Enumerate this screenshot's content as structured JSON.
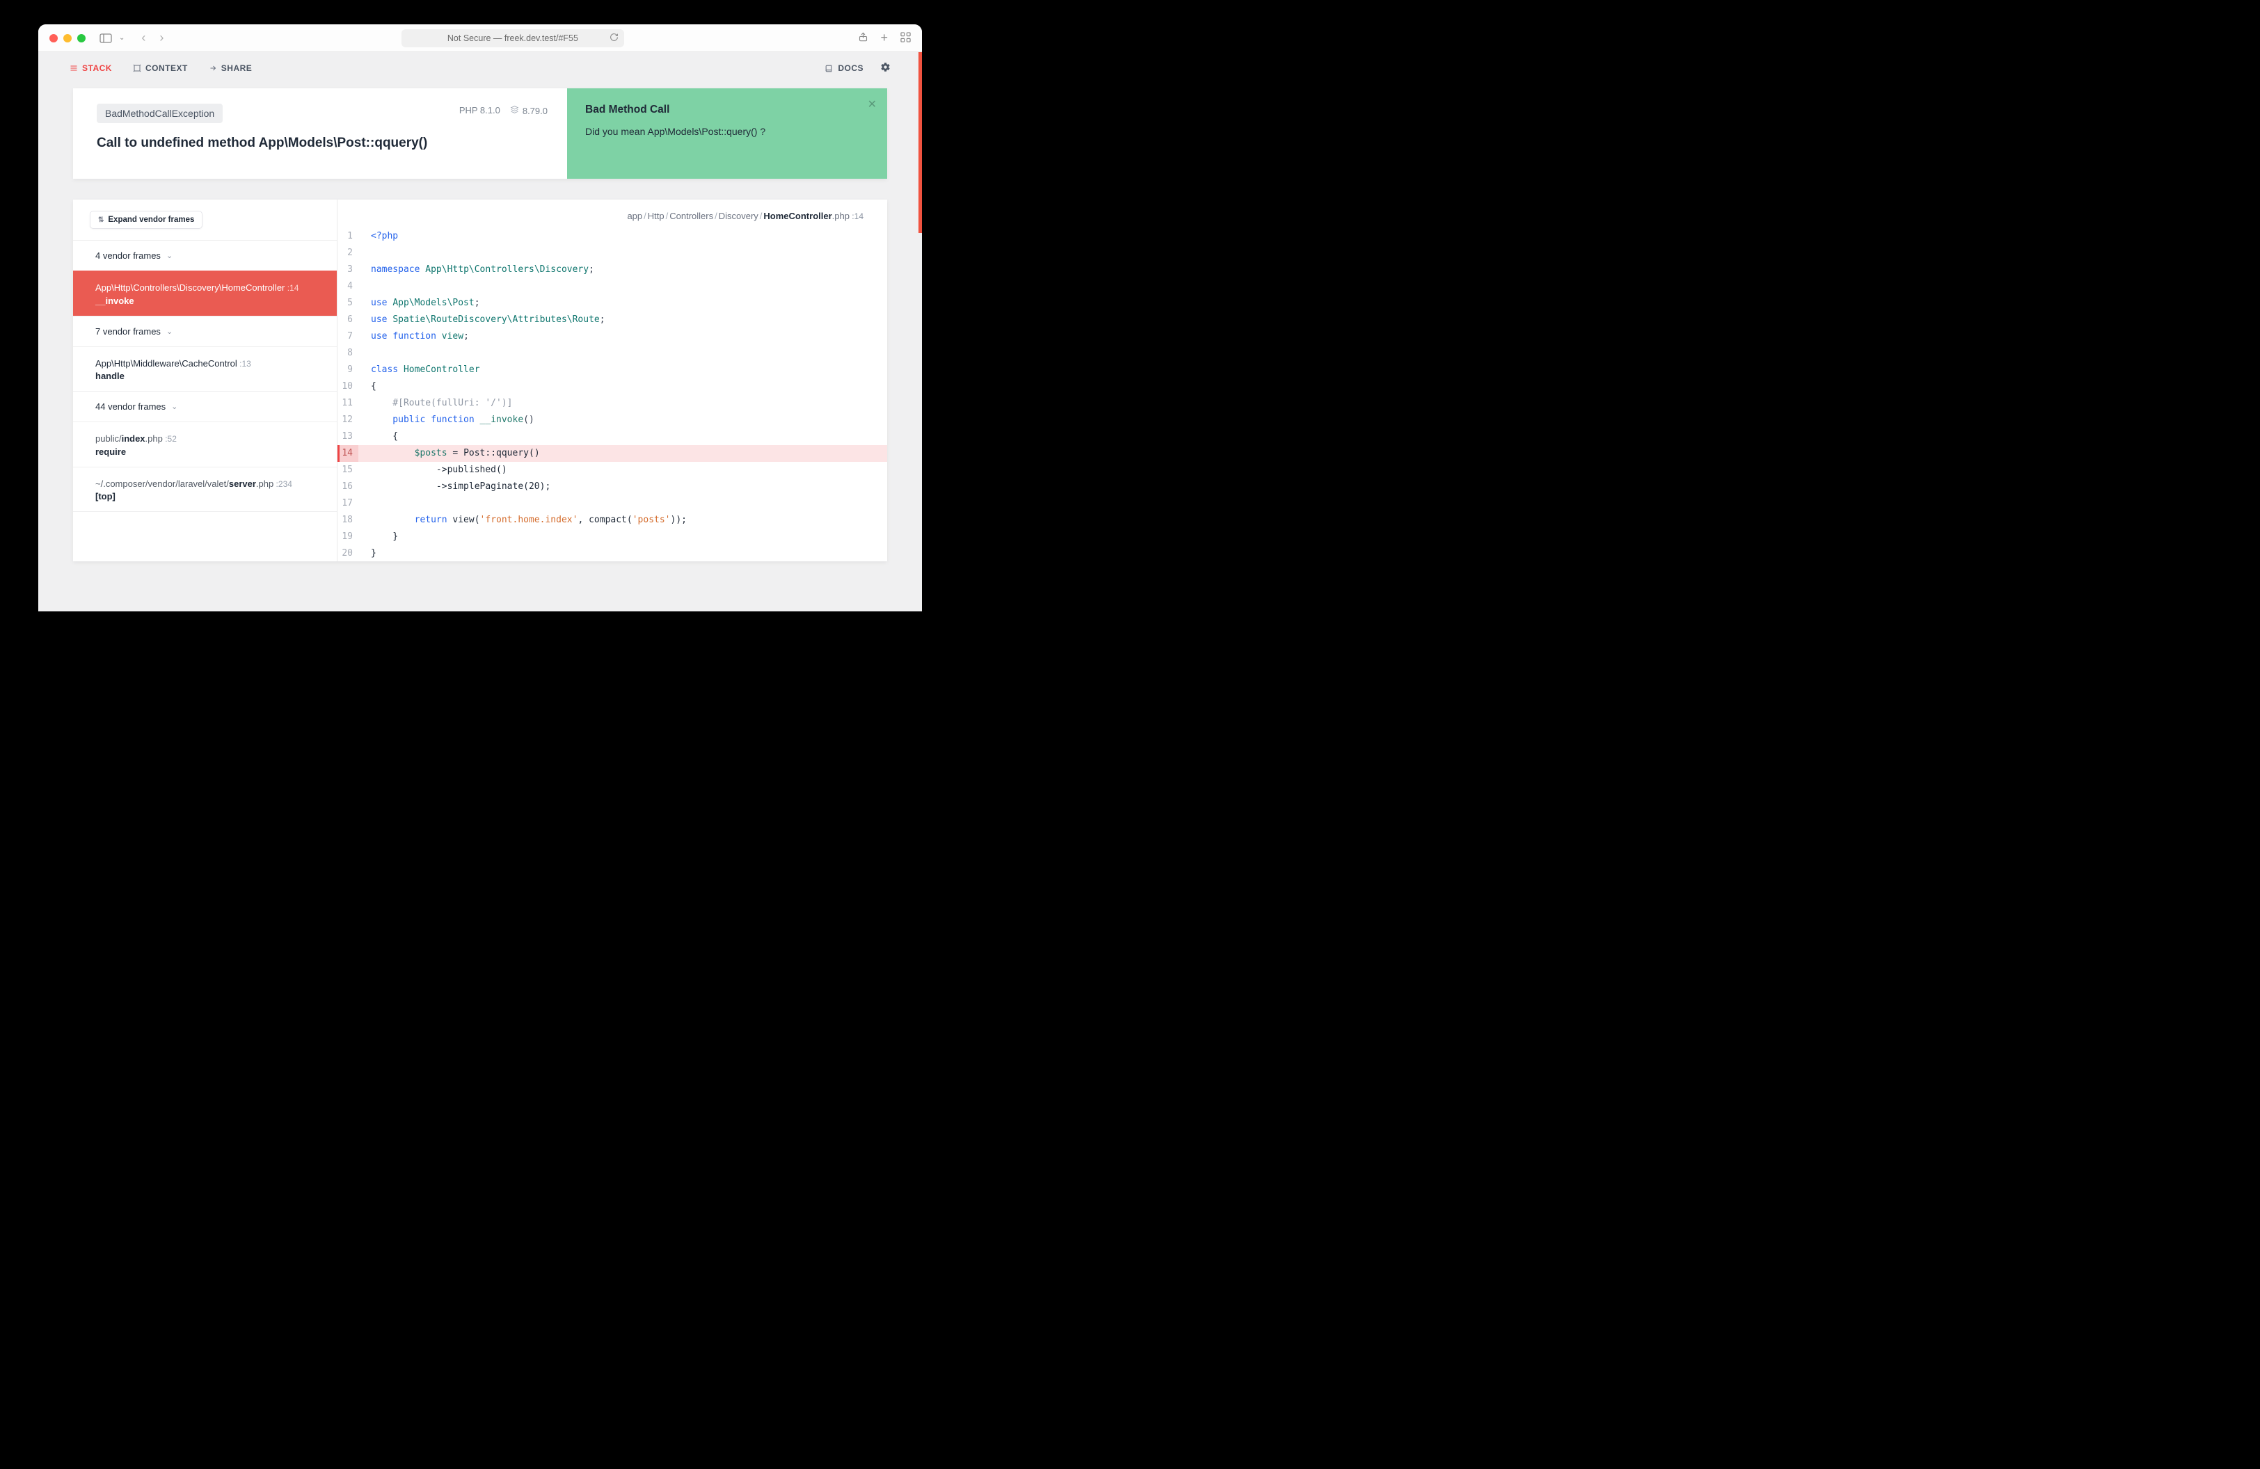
{
  "browser": {
    "address": "Not Secure — freek.dev.test/#F55"
  },
  "nav": {
    "stack": "STACK",
    "context": "CONTEXT",
    "share": "SHARE",
    "docs": "DOCS"
  },
  "header": {
    "exception_class": "BadMethodCallException",
    "message": "Call to undefined method App\\Models\\Post::qquery()",
    "php_version": "PHP 8.1.0",
    "laravel_version": "8.79.0"
  },
  "solution": {
    "title": "Bad Method Call",
    "body": "Did you mean App\\Models\\Post::query() ?"
  },
  "frames": {
    "expand_label": "Expand vendor frames",
    "group1": "4 vendor frames",
    "active": {
      "path": "App\\Http\\Controllers\\Discovery\\HomeController",
      "line": "14",
      "method": "__invoke"
    },
    "group2": "7 vendor frames",
    "middleware": {
      "path": "App\\Http\\Middleware\\CacheControl",
      "line": "13",
      "method": "handle"
    },
    "group3": "44 vendor frames",
    "public_index": {
      "prefix": "public/",
      "file": "index",
      "suffix": ".php",
      "line": "52",
      "method": "require"
    },
    "valet": {
      "prefix": "~/.composer/vendor/laravel/valet/",
      "file": "server",
      "suffix": ".php",
      "line": "234",
      "method": "[top]"
    }
  },
  "file_path": {
    "segments": [
      "app",
      "Http",
      "Controllers",
      "Discovery"
    ],
    "file": "HomeController",
    "ext": ".php",
    "line": "14"
  },
  "code": {
    "l1": "<?php",
    "l3_kw": "namespace ",
    "l3_ns": "App\\Http\\Controllers\\Discovery",
    "l5_kw": "use ",
    "l5_ns": "App\\Models\\Post",
    "l6_kw": "use ",
    "l6_ns": "Spatie\\RouteDiscovery\\Attributes\\Route",
    "l7_use": "use ",
    "l7_fn": "function ",
    "l7_name": "view",
    "l9_kw": "class ",
    "l9_name": "HomeController",
    "l10": "{",
    "l11": "    #[Route(fullUri: '/')]",
    "l12_pub": "    public ",
    "l12_fn": "function ",
    "l12_name": "__invoke",
    "l12_par": "()",
    "l13": "    {",
    "l14_pre": "        ",
    "l14_var": "$posts",
    "l14_rest": " = Post::qquery()",
    "l15": "            ->published()",
    "l16_a": "            ->simplePaginate(",
    "l16_num": "20",
    "l16_b": ");",
    "l18_ret": "        return ",
    "l18_view": "view(",
    "l18_s1": "'front.home.index'",
    "l18_mid": ", compact(",
    "l18_s2": "'posts'",
    "l18_end": "));",
    "l19": "    }",
    "l20": "}"
  }
}
